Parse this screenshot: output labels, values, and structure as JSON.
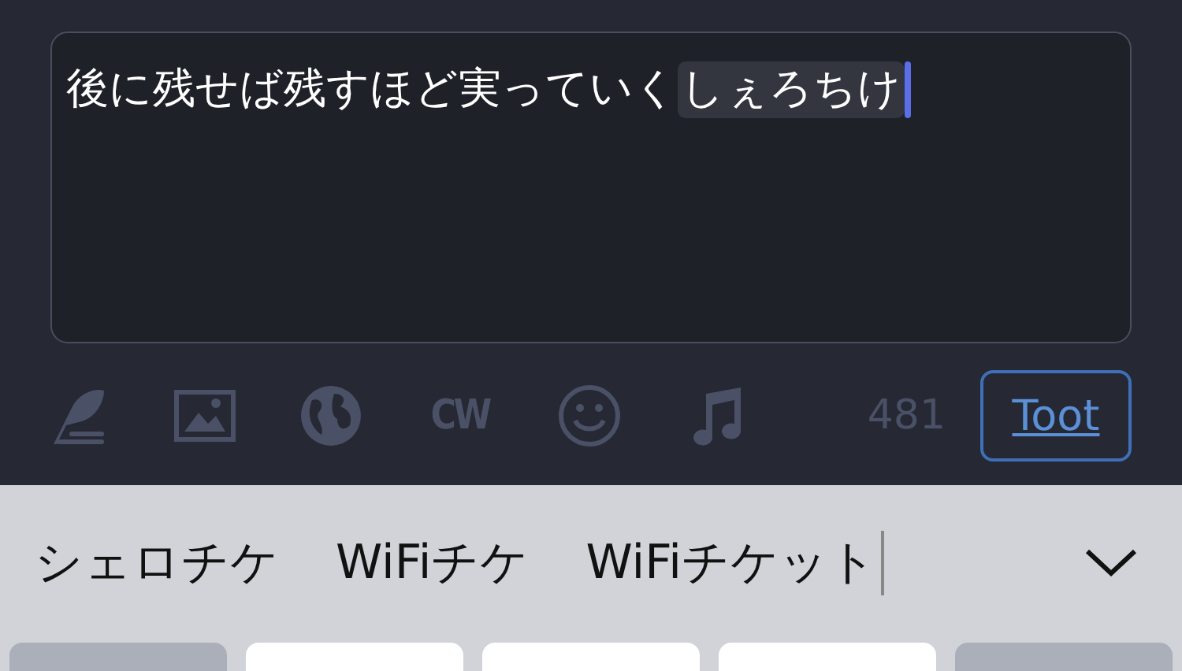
{
  "composer": {
    "text": "後に残せば残すほど実っていく",
    "composing": "しぇろちけ"
  },
  "toolbar": {
    "cw_label": "CW",
    "char_count": "481",
    "toot_label": "Toot"
  },
  "candidates": [
    "シェロチケ",
    "WiFiチケ",
    "WiFiチケット"
  ],
  "keys": [
    {
      "kind": "function"
    },
    {
      "kind": "letter"
    },
    {
      "kind": "letter"
    },
    {
      "kind": "letter"
    },
    {
      "kind": "function"
    }
  ]
}
